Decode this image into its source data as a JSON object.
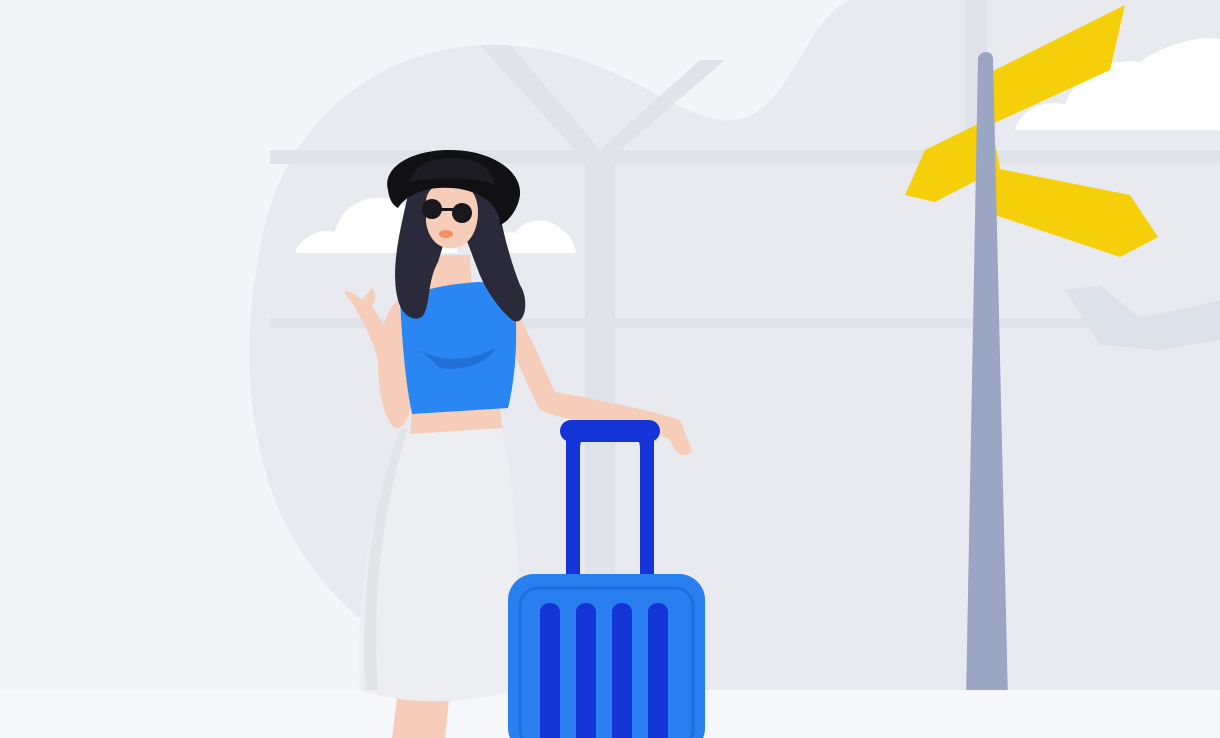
{
  "illustration": {
    "subject": "traveler-with-suitcase",
    "elements": [
      "woman-traveler",
      "suitcase",
      "signpost",
      "clouds",
      "airplane"
    ],
    "colors": {
      "background": "#f4f5f8",
      "blob": "#e7e9ef",
      "window_frame": "#e1e4eb",
      "cloud": "#ffffff",
      "sign": "#f5cf0a",
      "pole": "#9aa6c4",
      "top": "#2a86f2",
      "skirt": "#eceef1",
      "skin": "#f6cdb8",
      "hair": "#2b2a3a",
      "hat": "#111114",
      "suitcase": "#2a7ff0",
      "suitcase_dark": "#1434d8"
    }
  }
}
